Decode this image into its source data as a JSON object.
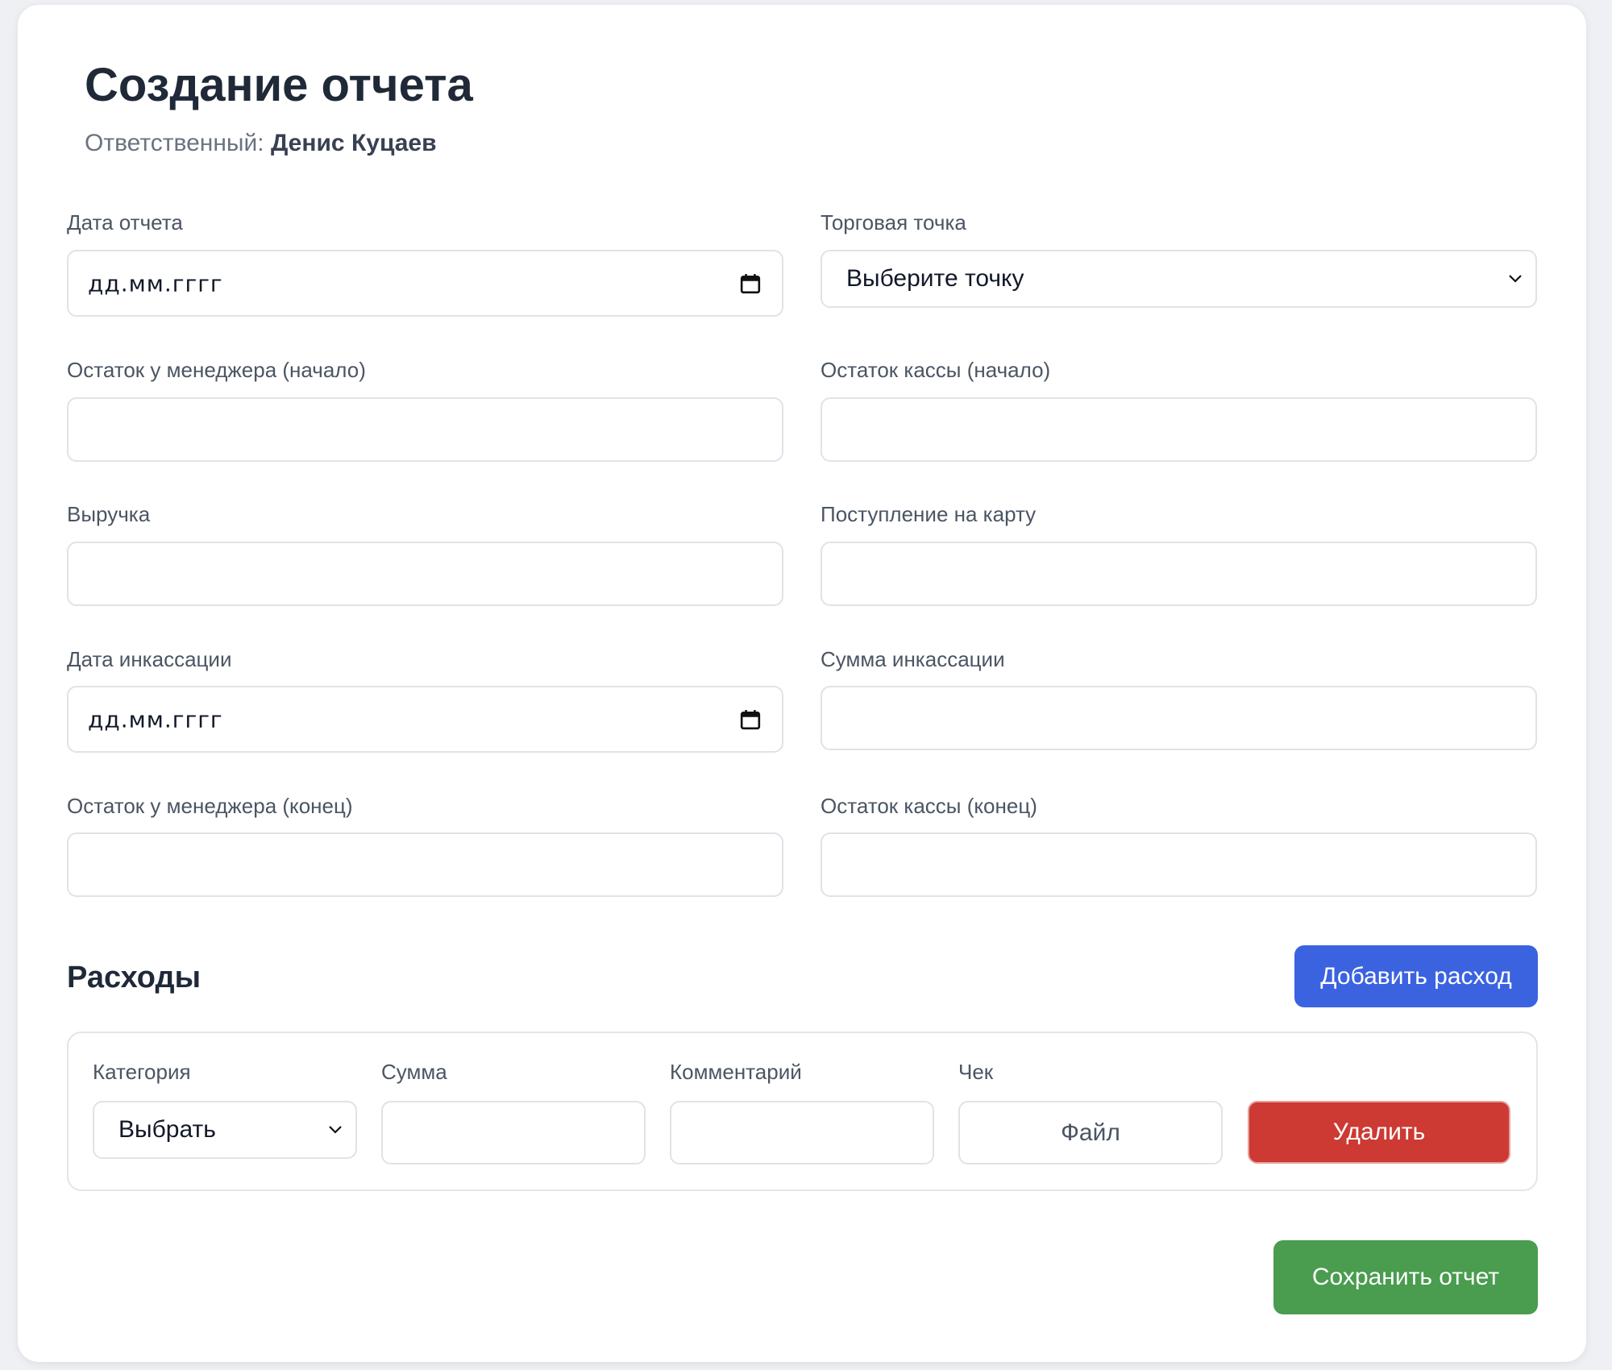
{
  "form": {
    "title": "Создание отчета",
    "responsible_label": "Ответственный:",
    "responsible_name": "Денис Куцаев",
    "fields": {
      "report_date": {
        "label": "Дата отчета",
        "placeholder": "дд.мм.гггг"
      },
      "outlet": {
        "label": "Торговая точка",
        "selected": "Выберите точку"
      },
      "manager_start": {
        "label": "Остаток у менеджера (начало)",
        "value": ""
      },
      "cash_start": {
        "label": "Остаток кассы (начало)",
        "value": ""
      },
      "revenue": {
        "label": "Выручка",
        "value": ""
      },
      "card_income": {
        "label": "Поступление на карту",
        "value": ""
      },
      "collection_date": {
        "label": "Дата инкассации",
        "placeholder": "дд.мм.гггг"
      },
      "collection_sum": {
        "label": "Сумма инкассации",
        "value": ""
      },
      "manager_end": {
        "label": "Остаток у менеджера (конец)",
        "value": ""
      },
      "cash_end": {
        "label": "Остаток кассы (конец)",
        "value": ""
      }
    }
  },
  "expenses": {
    "title": "Расходы",
    "add_button": "Добавить расход",
    "columns": {
      "category": "Категория",
      "sum": "Сумма",
      "comment": "Комментарий",
      "receipt": "Чек"
    },
    "row": {
      "category_selected": "Выбрать",
      "sum": "",
      "comment": "",
      "file_button": "Файл",
      "delete_button": "Удалить"
    }
  },
  "save_button": "Сохранить отчет",
  "icons": {
    "calendar": "calendar-icon",
    "dropdown": "chevron-down-icon"
  },
  "colors": {
    "primary": "#3b63e0",
    "danger": "#cc3a33",
    "success": "#4a9c4f"
  }
}
